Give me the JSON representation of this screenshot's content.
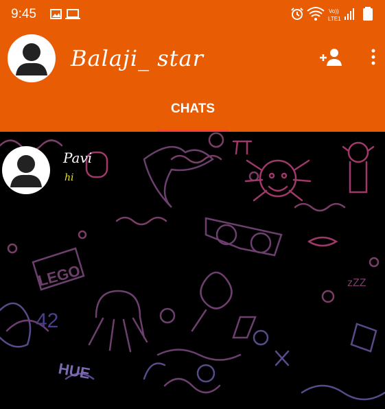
{
  "status_bar": {
    "time": "9:45",
    "left_icons": [
      "gallery-icon",
      "laptop-icon"
    ],
    "right_icons": [
      "alarm-icon",
      "wifi-icon",
      "volte-icon",
      "signal-icon",
      "battery-icon"
    ],
    "volte_label": "Vo))",
    "lte_label": "LTE1"
  },
  "header": {
    "title": "Balaji_ star",
    "actions": [
      "add-contact-icon",
      "more-vert-icon"
    ]
  },
  "tabs": [
    {
      "label": "CHATS",
      "selected": true
    }
  ],
  "chats": [
    {
      "name": "Pavi",
      "message": "hi"
    }
  ],
  "background_text": {
    "lego": "LEGO",
    "hue": "HUE",
    "num": "42",
    "zzz": "zZZ"
  },
  "colors": {
    "brand": "#e85d04",
    "tab_indicator": "#ff3b3b",
    "message_preview": "#e8e13a"
  }
}
